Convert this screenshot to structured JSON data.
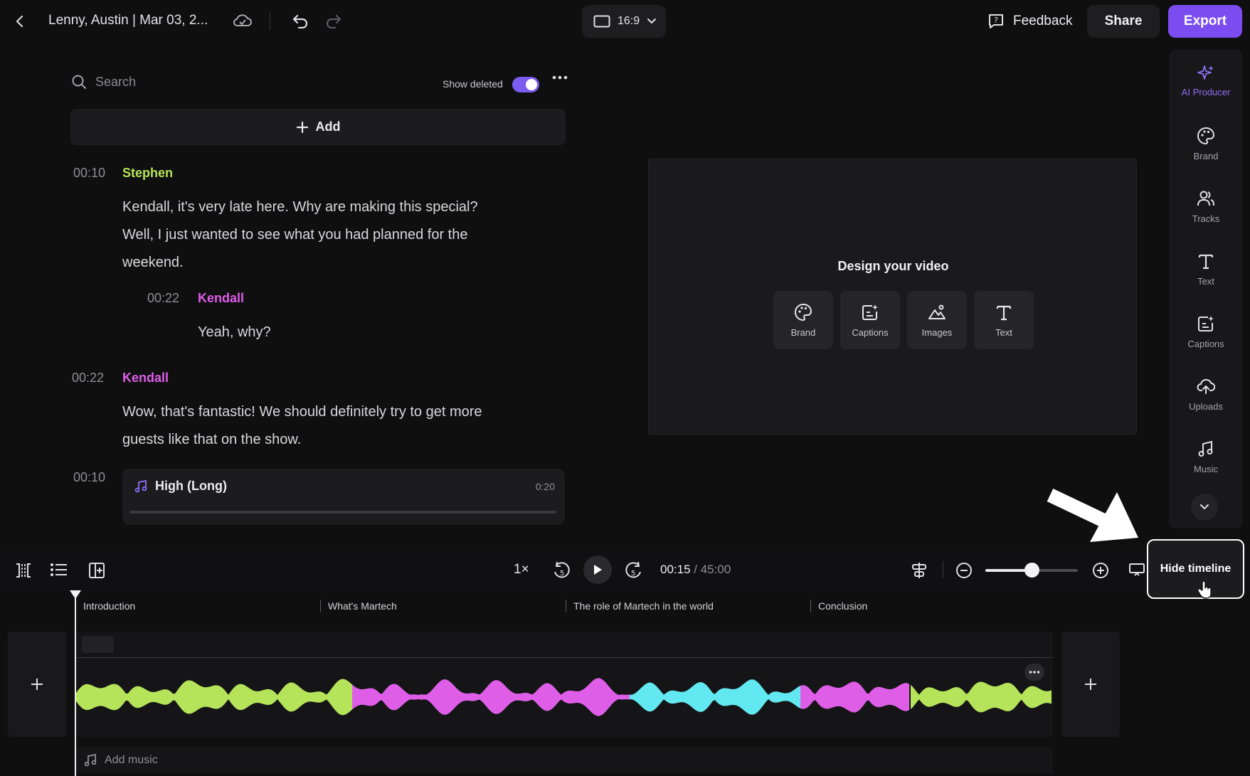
{
  "header": {
    "title": "Lenny, Austin | Mar 03, 2...",
    "aspect_ratio": "16:9",
    "feedback_label": "Feedback",
    "share_label": "Share",
    "export_label": "Export",
    "accent_color": "#7b4cf0"
  },
  "transcript": {
    "search_placeholder": "Search",
    "show_deleted_label": "Show deleted",
    "show_deleted_on": true,
    "add_label": "Add",
    "entries": [
      {
        "time": "00:10",
        "speaker": "Stephen",
        "color": "#b5e35a",
        "lines": [
          "Kendall, it's very late here. Why are making this special?",
          "Well, I just wanted to see what you had planned for the",
          "weekend."
        ]
      },
      {
        "time": "00:22",
        "speaker": "Kendall",
        "color": "#de5ee8",
        "lines": [
          "Yeah, why?"
        ]
      },
      {
        "time": "00:22",
        "speaker": "Kendall",
        "color": "#de5ee8",
        "lines": [
          "Wow, that's fantastic! We should definitely try to get more",
          "guests like that on the show."
        ]
      }
    ],
    "music": {
      "time": "00:10",
      "name": "High (Long)",
      "duration": "0:20"
    }
  },
  "preview": {
    "title": "Design your video",
    "options": [
      "Brand",
      "Captions",
      "Images",
      "Text"
    ]
  },
  "sidebar": {
    "items": [
      "AI Producer",
      "Brand",
      "Tracks",
      "Text",
      "Captions",
      "Uploads",
      "Music"
    ]
  },
  "timeline": {
    "speed": "1×",
    "current_time": "00:15",
    "total_time": "/ 45:00",
    "hide_timeline_label": "Hide timeline",
    "chapters": [
      "Introduction",
      "What's Martech",
      "The role of Martech in the world",
      "Conclusion"
    ],
    "add_music_label": "Add music",
    "wave_colors": {
      "stephen": "#b5e35a",
      "kendall": "#de5ee8",
      "other": "#62e8f0"
    }
  }
}
